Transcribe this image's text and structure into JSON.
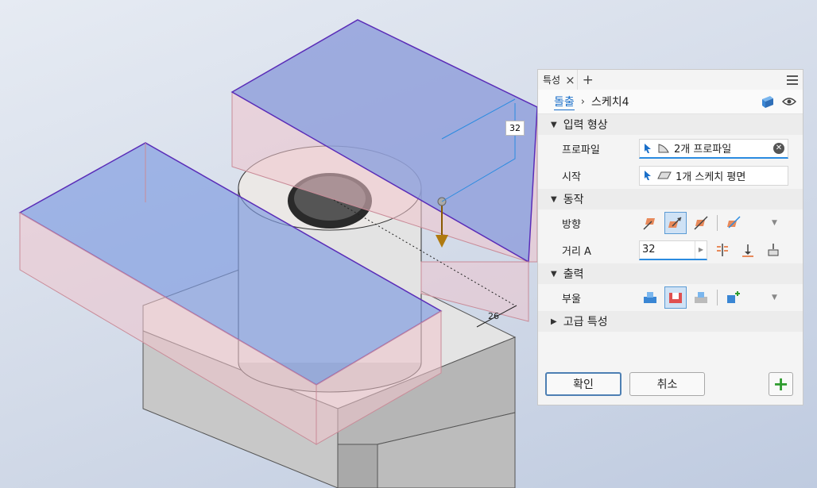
{
  "viewport": {
    "dim_distance": "32",
    "dim_width": "26"
  },
  "panel": {
    "tab_label": "특성",
    "breadcrumb": {
      "feature": "돌출",
      "sketch": "스케치4"
    },
    "sections": {
      "input": "입력 형상",
      "behavior": "동작",
      "output": "출력",
      "advanced": "고급 특성"
    },
    "rows": {
      "profile_label": "프로파일",
      "profile_value": "2개 프로파일",
      "start_label": "시작",
      "start_value": "1개 스케치 평면",
      "direction_label": "방향",
      "distance_label": "거리 A",
      "distance_value": "32",
      "boolean_label": "부울"
    },
    "buttons": {
      "ok": "확인",
      "cancel": "취소",
      "add": "+"
    }
  }
}
